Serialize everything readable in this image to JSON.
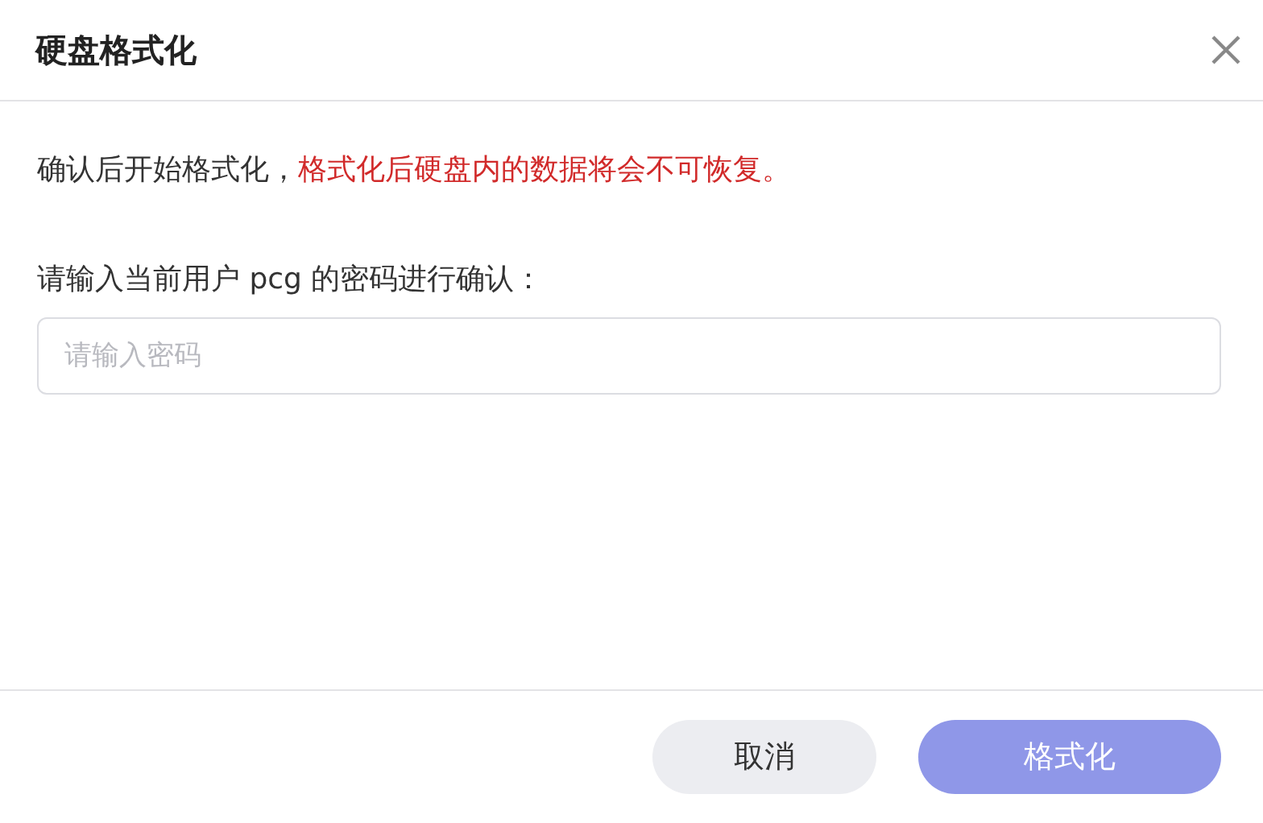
{
  "dialog": {
    "title": "硬盘格式化"
  },
  "message": {
    "text": "确认后开始格式化，",
    "warning": "格式化后硬盘内的数据将会不可恢复。"
  },
  "password": {
    "label": "请输入当前用户 pcg 的密码进行确认：",
    "placeholder": "请输入密码"
  },
  "buttons": [
    {
      "label": "取消",
      "kind": "secondary",
      "disabled": false
    },
    {
      "label": "格式化",
      "kind": "primary",
      "disabled": true
    }
  ]
}
